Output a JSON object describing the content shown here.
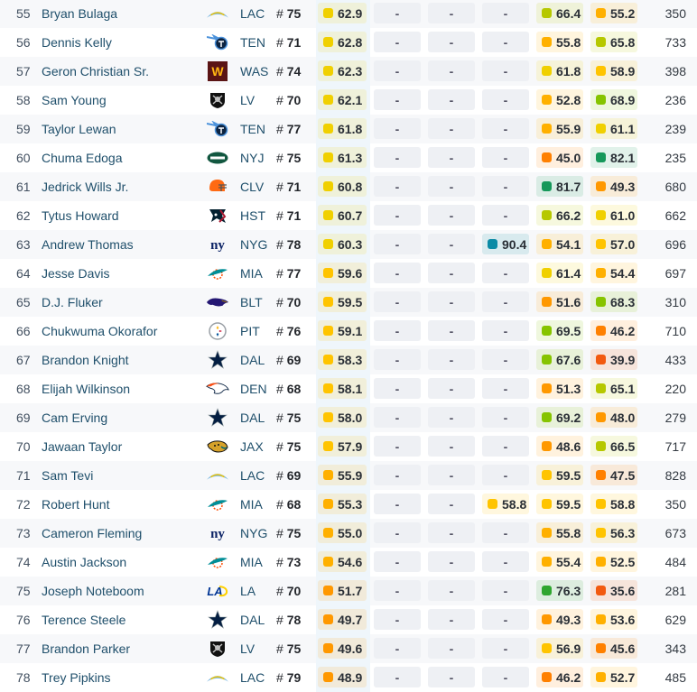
{
  "empty_value": "-",
  "grade_colors": {
    "elite_teal": "#0a8aa5",
    "dark_green": "#16985a",
    "green": "#2fa62f",
    "lime": "#86c400",
    "yellow_green": "#b6c800",
    "yellow": "#f0d000",
    "gold": "#ffc400",
    "light_orange": "#ffb000",
    "orange": "#ff9800",
    "dark_orange": "#ff8000",
    "red_orange": "#f25a10"
  },
  "rows": [
    {
      "rank": "55",
      "name": "Bryan Bulaga",
      "team": "LAC",
      "logo": "chargers-logo",
      "jersey_prefix": "#",
      "jersey": "75",
      "overall": "62.9",
      "col_a": "-",
      "col_b": "-",
      "col_c": "-",
      "col_d": "66.4",
      "col_e": "55.2",
      "snaps": "350"
    },
    {
      "rank": "56",
      "name": "Dennis Kelly",
      "team": "TEN",
      "logo": "titans-logo",
      "jersey_prefix": "#",
      "jersey": "71",
      "overall": "62.8",
      "col_a": "-",
      "col_b": "-",
      "col_c": "-",
      "col_d": "55.8",
      "col_e": "65.8",
      "snaps": "733"
    },
    {
      "rank": "57",
      "name": "Geron Christian Sr.",
      "team": "WAS",
      "logo": "washington-logo",
      "jersey_prefix": "#",
      "jersey": "74",
      "overall": "62.3",
      "col_a": "-",
      "col_b": "-",
      "col_c": "-",
      "col_d": "61.8",
      "col_e": "58.9",
      "snaps": "398"
    },
    {
      "rank": "58",
      "name": "Sam Young",
      "team": "LV",
      "logo": "raiders-logo",
      "jersey_prefix": "#",
      "jersey": "70",
      "overall": "62.1",
      "col_a": "-",
      "col_b": "-",
      "col_c": "-",
      "col_d": "52.8",
      "col_e": "68.9",
      "snaps": "236"
    },
    {
      "rank": "59",
      "name": "Taylor Lewan",
      "team": "TEN",
      "logo": "titans-logo",
      "jersey_prefix": "#",
      "jersey": "77",
      "overall": "61.8",
      "col_a": "-",
      "col_b": "-",
      "col_c": "-",
      "col_d": "55.9",
      "col_e": "61.1",
      "snaps": "239"
    },
    {
      "rank": "60",
      "name": "Chuma Edoga",
      "team": "NYJ",
      "logo": "jets-logo",
      "jersey_prefix": "#",
      "jersey": "75",
      "overall": "61.3",
      "col_a": "-",
      "col_b": "-",
      "col_c": "-",
      "col_d": "45.0",
      "col_e": "82.1",
      "snaps": "235"
    },
    {
      "rank": "61",
      "name": "Jedrick Wills Jr.",
      "team": "CLV",
      "logo": "browns-logo",
      "jersey_prefix": "#",
      "jersey": "71",
      "overall": "60.8",
      "col_a": "-",
      "col_b": "-",
      "col_c": "-",
      "col_d": "81.7",
      "col_e": "49.3",
      "snaps": "680"
    },
    {
      "rank": "62",
      "name": "Tytus Howard",
      "team": "HST",
      "logo": "texans-logo",
      "jersey_prefix": "#",
      "jersey": "71",
      "overall": "60.7",
      "col_a": "-",
      "col_b": "-",
      "col_c": "-",
      "col_d": "66.2",
      "col_e": "61.0",
      "snaps": "662"
    },
    {
      "rank": "63",
      "name": "Andrew Thomas",
      "team": "NYG",
      "logo": "giants-logo",
      "jersey_prefix": "#",
      "jersey": "78",
      "overall": "60.3",
      "col_a": "-",
      "col_b": "-",
      "col_c": "90.4",
      "col_d": "54.1",
      "col_e": "57.0",
      "snaps": "696"
    },
    {
      "rank": "64",
      "name": "Jesse Davis",
      "team": "MIA",
      "logo": "dolphins-logo",
      "jersey_prefix": "#",
      "jersey": "77",
      "overall": "59.6",
      "col_a": "-",
      "col_b": "-",
      "col_c": "-",
      "col_d": "61.4",
      "col_e": "54.4",
      "snaps": "697"
    },
    {
      "rank": "65",
      "name": "D.J. Fluker",
      "team": "BLT",
      "logo": "ravens-logo",
      "jersey_prefix": "#",
      "jersey": "70",
      "overall": "59.5",
      "col_a": "-",
      "col_b": "-",
      "col_c": "-",
      "col_d": "51.6",
      "col_e": "68.3",
      "snaps": "310"
    },
    {
      "rank": "66",
      "name": "Chukwuma Okorafor",
      "team": "PIT",
      "logo": "steelers-logo",
      "jersey_prefix": "#",
      "jersey": "76",
      "overall": "59.1",
      "col_a": "-",
      "col_b": "-",
      "col_c": "-",
      "col_d": "69.5",
      "col_e": "46.2",
      "snaps": "710"
    },
    {
      "rank": "67",
      "name": "Brandon Knight",
      "team": "DAL",
      "logo": "cowboys-logo",
      "jersey_prefix": "#",
      "jersey": "69",
      "overall": "58.3",
      "col_a": "-",
      "col_b": "-",
      "col_c": "-",
      "col_d": "67.6",
      "col_e": "39.9",
      "snaps": "433"
    },
    {
      "rank": "68",
      "name": "Elijah Wilkinson",
      "team": "DEN",
      "logo": "broncos-logo",
      "jersey_prefix": "#",
      "jersey": "68",
      "overall": "58.1",
      "col_a": "-",
      "col_b": "-",
      "col_c": "-",
      "col_d": "51.3",
      "col_e": "65.1",
      "snaps": "220"
    },
    {
      "rank": "69",
      "name": "Cam Erving",
      "team": "DAL",
      "logo": "cowboys-logo",
      "jersey_prefix": "#",
      "jersey": "75",
      "overall": "58.0",
      "col_a": "-",
      "col_b": "-",
      "col_c": "-",
      "col_d": "69.2",
      "col_e": "48.0",
      "snaps": "279"
    },
    {
      "rank": "70",
      "name": "Jawaan Taylor",
      "team": "JAX",
      "logo": "jaguars-logo",
      "jersey_prefix": "#",
      "jersey": "75",
      "overall": "57.9",
      "col_a": "-",
      "col_b": "-",
      "col_c": "-",
      "col_d": "48.6",
      "col_e": "66.5",
      "snaps": "717"
    },
    {
      "rank": "71",
      "name": "Sam Tevi",
      "team": "LAC",
      "logo": "chargers-logo",
      "jersey_prefix": "#",
      "jersey": "69",
      "overall": "55.9",
      "col_a": "-",
      "col_b": "-",
      "col_c": "-",
      "col_d": "59.5",
      "col_e": "47.5",
      "snaps": "828"
    },
    {
      "rank": "72",
      "name": "Robert Hunt",
      "team": "MIA",
      "logo": "dolphins-logo",
      "jersey_prefix": "#",
      "jersey": "68",
      "overall": "55.3",
      "col_a": "-",
      "col_b": "-",
      "col_c": "58.8",
      "col_d": "59.5",
      "col_e": "58.8",
      "snaps": "350"
    },
    {
      "rank": "73",
      "name": "Cameron Fleming",
      "team": "NYG",
      "logo": "giants-logo",
      "jersey_prefix": "#",
      "jersey": "75",
      "overall": "55.0",
      "col_a": "-",
      "col_b": "-",
      "col_c": "-",
      "col_d": "55.8",
      "col_e": "56.3",
      "snaps": "673"
    },
    {
      "rank": "74",
      "name": "Austin Jackson",
      "team": "MIA",
      "logo": "dolphins-logo",
      "jersey_prefix": "#",
      "jersey": "73",
      "overall": "54.6",
      "col_a": "-",
      "col_b": "-",
      "col_c": "-",
      "col_d": "55.4",
      "col_e": "52.5",
      "snaps": "484"
    },
    {
      "rank": "75",
      "name": "Joseph Noteboom",
      "team": "LA",
      "logo": "rams-logo",
      "jersey_prefix": "#",
      "jersey": "70",
      "overall": "51.7",
      "col_a": "-",
      "col_b": "-",
      "col_c": "-",
      "col_d": "76.3",
      "col_e": "35.6",
      "snaps": "281"
    },
    {
      "rank": "76",
      "name": "Terence Steele",
      "team": "DAL",
      "logo": "cowboys-logo",
      "jersey_prefix": "#",
      "jersey": "78",
      "overall": "49.7",
      "col_a": "-",
      "col_b": "-",
      "col_c": "-",
      "col_d": "49.3",
      "col_e": "53.6",
      "snaps": "629"
    },
    {
      "rank": "77",
      "name": "Brandon Parker",
      "team": "LV",
      "logo": "raiders-logo",
      "jersey_prefix": "#",
      "jersey": "75",
      "overall": "49.6",
      "col_a": "-",
      "col_b": "-",
      "col_c": "-",
      "col_d": "56.9",
      "col_e": "45.6",
      "snaps": "343"
    },
    {
      "rank": "78",
      "name": "Trey Pipkins",
      "team": "LAC",
      "logo": "chargers-logo",
      "jersey_prefix": "#",
      "jersey": "79",
      "overall": "48.9",
      "col_a": "-",
      "col_b": "-",
      "col_c": "-",
      "col_d": "46.2",
      "col_e": "52.7",
      "snaps": "485"
    }
  ]
}
